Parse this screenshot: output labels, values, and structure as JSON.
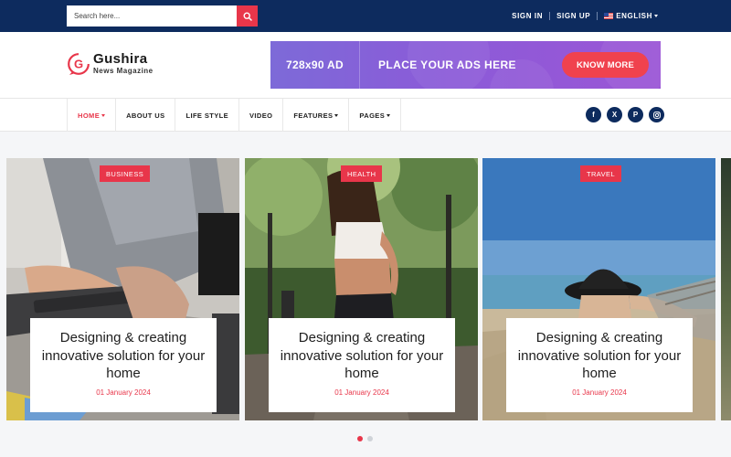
{
  "topbar": {
    "search_placeholder": "Search here...",
    "sign_in": "SIGN IN",
    "sign_up": "SIGN UP",
    "language": "ENGLISH"
  },
  "logo": {
    "name": "Gushira",
    "tagline": "News Magazine"
  },
  "ad": {
    "size": "728x90 AD",
    "text": "PLACE YOUR ADS HERE",
    "button": "KNOW MORE"
  },
  "nav": {
    "items": [
      {
        "label": "HOME",
        "dropdown": true,
        "active": true
      },
      {
        "label": "ABOUT US",
        "dropdown": false,
        "active": false
      },
      {
        "label": "LIFE STYLE",
        "dropdown": false,
        "active": false
      },
      {
        "label": "VIDEO",
        "dropdown": false,
        "active": false
      },
      {
        "label": "FEATURES",
        "dropdown": true,
        "active": false
      },
      {
        "label": "PAGES",
        "dropdown": true,
        "active": false
      }
    ],
    "socials": [
      "facebook-icon",
      "x-icon",
      "pinterest-icon",
      "instagram-icon"
    ]
  },
  "slides": [
    {
      "category": "BUSINESS",
      "title": "Designing & creating innovative solution for your home",
      "date": "01 January 2024"
    },
    {
      "category": "HEALTH",
      "title": "Designing & creating innovative solution for your home",
      "date": "01 January 2024"
    },
    {
      "category": "TRAVEL",
      "title": "Designing & creating innovative solution for your home",
      "date": "01 January 2024"
    }
  ],
  "pagination": {
    "count": 2,
    "active_index": 0
  },
  "colors": {
    "navy": "#0d2b5e",
    "accent": "#e8364a",
    "ad_purple": "#8a5cd8"
  }
}
